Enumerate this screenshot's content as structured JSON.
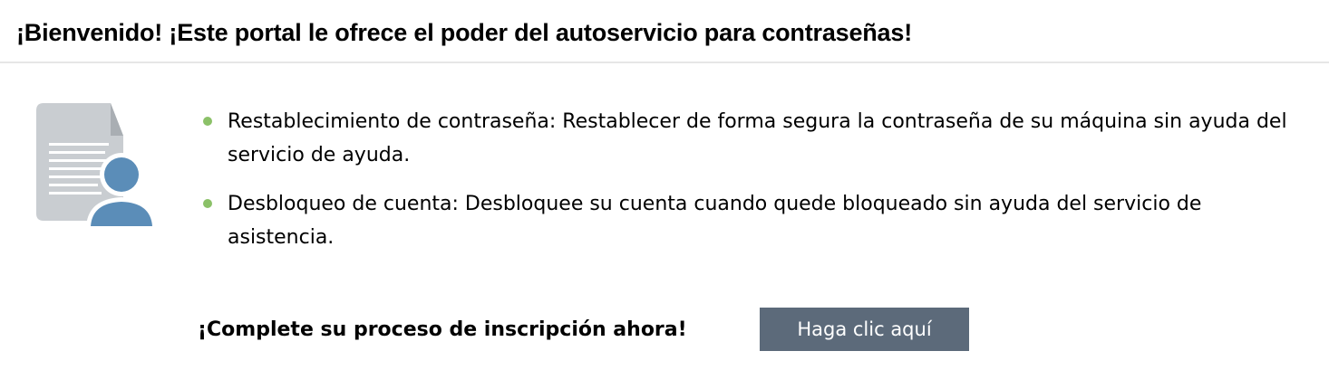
{
  "header": {
    "title": "¡Bienvenido! ¡Este portal le ofrece el poder del autoservicio para contraseñas!"
  },
  "illustration": {
    "icon": "document-user-icon",
    "colors": {
      "document": "#c9cdd1",
      "fold": "#a9aeb3",
      "lines": "#ffffff",
      "user": "#5b8db8"
    }
  },
  "features": [
    {
      "text": "Restablecimiento de contraseña: Restablecer de forma segura la contraseña de su máquina sin ayuda del servicio de ayuda."
    },
    {
      "text": "Desbloqueo de cuenta: Desbloquee su cuenta cuando quede bloqueado sin ayuda del servicio de asistencia."
    }
  ],
  "cta": {
    "text": "¡Complete su proceso de inscripción ahora!",
    "button_label": "Haga clic aquí"
  },
  "colors": {
    "bullet": "#8bc168",
    "button_bg": "#5c6a7a",
    "button_text": "#ffffff",
    "divider": "#e6e6e6"
  }
}
